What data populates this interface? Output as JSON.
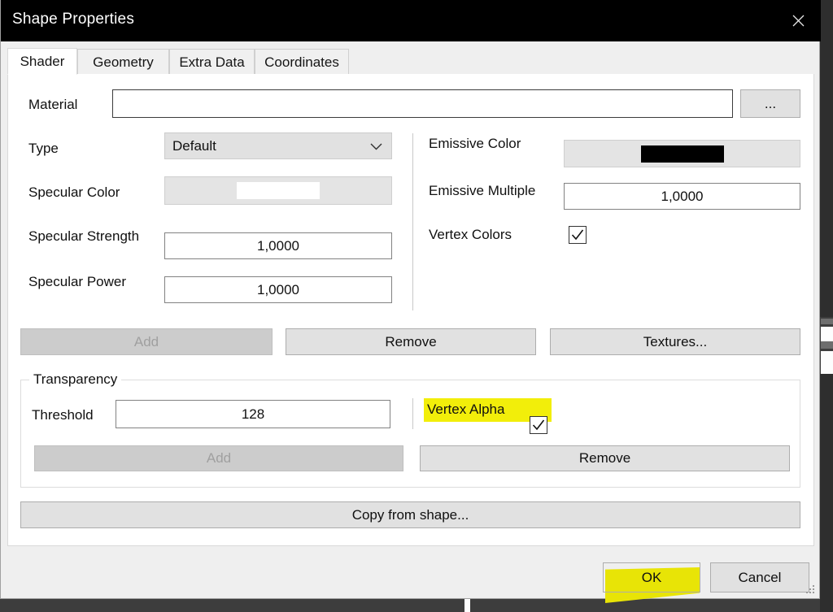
{
  "window": {
    "title": "Shape Properties",
    "close_icon": "close-icon"
  },
  "tabs": [
    {
      "label": "Shader",
      "active": true
    },
    {
      "label": "Geometry",
      "active": false
    },
    {
      "label": "Extra Data",
      "active": false
    },
    {
      "label": "Coordinates",
      "active": false
    }
  ],
  "shader": {
    "material": {
      "label": "Material",
      "value": "",
      "placeholder": "",
      "browse_label": "..."
    },
    "type": {
      "label": "Type",
      "value": "Default",
      "options": [
        "Default"
      ]
    },
    "specular_color": {
      "label": "Specular Color",
      "color": "#ffffff"
    },
    "specular_strength": {
      "label": "Specular Strength",
      "value": "1,0000"
    },
    "specular_power": {
      "label": "Specular Power",
      "value": "1,0000"
    },
    "emissive_color": {
      "label": "Emissive Color",
      "color": "#000000"
    },
    "emissive_multiple": {
      "label": "Emissive Multiple",
      "value": "1,0000"
    },
    "vertex_colors": {
      "label": "Vertex Colors",
      "checked": true
    },
    "buttons": {
      "add_label": "Add",
      "add_disabled": true,
      "remove_label": "Remove",
      "textures_label": "Textures..."
    },
    "transparency": {
      "group_label": "Transparency",
      "threshold_label": "Threshold",
      "threshold_value": "128",
      "vertex_alpha_label": "Vertex Alpha",
      "vertex_alpha_checked": true,
      "vertex_alpha_highlighted": true,
      "add_label": "Add",
      "add_disabled": true,
      "remove_label": "Remove"
    },
    "copy_from_shape_label": "Copy from shape..."
  },
  "footer": {
    "ok_label": "OK",
    "ok_highlighted": true,
    "cancel_label": "Cancel"
  },
  "colors": {
    "highlight": "#f2ee0a",
    "titlebar_bg": "#000000",
    "dialog_bg": "#efefef",
    "panel_bg": "#ffffff",
    "button_bg": "#e1e1e1",
    "disabled_bg": "#cccccc"
  }
}
